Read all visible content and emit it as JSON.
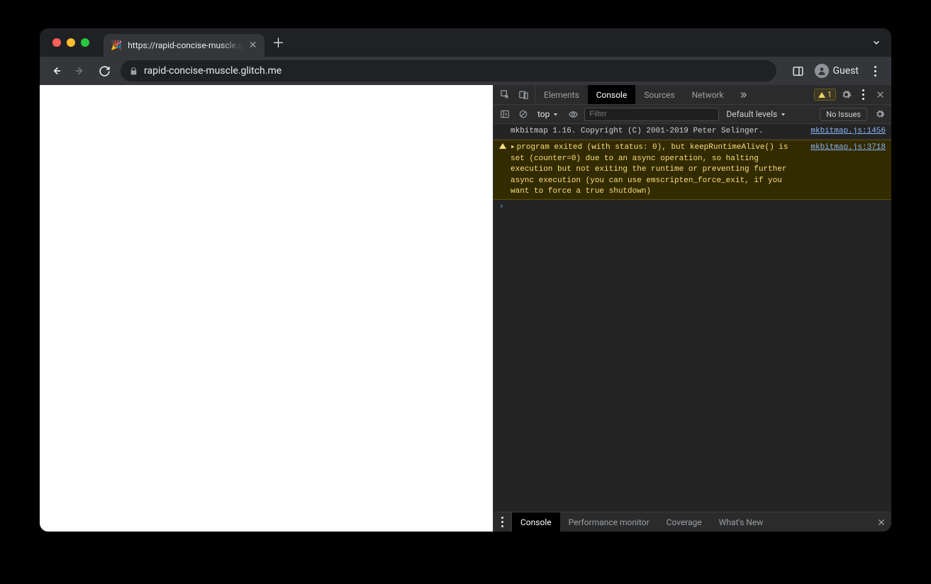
{
  "browser": {
    "tab_title": "https://rapid-concise-muscle.g",
    "favicon": "🎉",
    "url_display": "rapid-concise-muscle.glitch.me",
    "guest_label": "Guest"
  },
  "devtools": {
    "tabs": {
      "elements": "Elements",
      "console": "Console",
      "sources": "Sources",
      "network": "Network"
    },
    "warning_count": "1",
    "console_bar": {
      "context": "top",
      "filter_placeholder": "Filter",
      "levels": "Default levels",
      "issues_label": "No Issues"
    },
    "messages": {
      "log1_text": "mkbitmap 1.16. Copyright (C) 2001-2019 Peter Selinger.",
      "log1_source": "mkbitmap.js:1456",
      "warn1_text": "program exited (with status: 0), but keepRuntimeAlive() is set (counter=0) due to an async operation, so halting execution but not exiting the runtime or preventing further async execution (you can use emscripten_force_exit, if you want to force a true shutdown)",
      "warn1_source": "mkbitmap.js:3718"
    },
    "drawer": {
      "console": "Console",
      "perf": "Performance monitor",
      "coverage": "Coverage",
      "whatsnew": "What's New"
    }
  }
}
